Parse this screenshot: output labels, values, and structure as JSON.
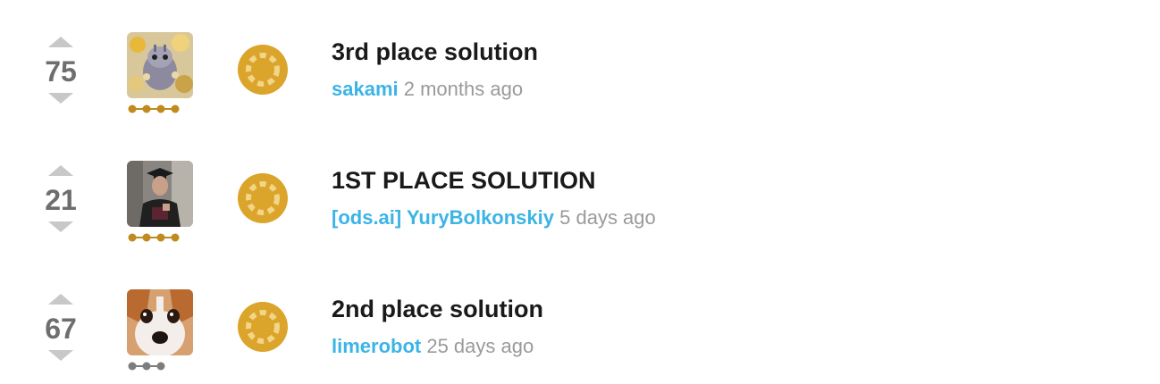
{
  "topics": [
    {
      "votes": "75",
      "title": "3rd place solution",
      "author": "sakami",
      "time": " 2 months ago",
      "tier_color": "#c08a1e",
      "avatar_icon": "sakami-avatar-icon"
    },
    {
      "votes": "21",
      "title": "1ST PLACE SOLUTION",
      "author": "[ods.ai] YuryBolkonskiy",
      "time": " 5 days ago",
      "tier_color": "#c08a1e",
      "avatar_icon": "yury-avatar-icon"
    },
    {
      "votes": "67",
      "title": "2nd place solution",
      "author": "limerobot",
      "time": " 25 days ago",
      "tier_color": "#7d7d7d",
      "avatar_icon": "limerobot-avatar-icon"
    }
  ],
  "colors": {
    "medal_gold": "#dba42a",
    "medal_ring": "#f2d588",
    "link": "#3bb4e6",
    "arrow": "#c8c8c8"
  }
}
